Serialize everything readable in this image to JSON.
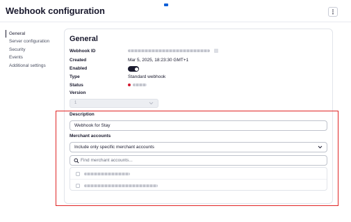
{
  "header": {
    "title": "Webhook configuration",
    "more_icon": "more-vertical-icon"
  },
  "sidebar": {
    "items": [
      {
        "label": "General",
        "active": true
      },
      {
        "label": "Server configuration",
        "active": false
      },
      {
        "label": "Security",
        "active": false
      },
      {
        "label": "Events",
        "active": false
      },
      {
        "label": "Additional settings",
        "active": false
      }
    ]
  },
  "general": {
    "title": "General",
    "fields": {
      "webhook_id": {
        "label": "Webhook ID"
      },
      "created": {
        "label": "Created",
        "value": "Mar 5, 2025, 18:23:30 GMT+1"
      },
      "enabled": {
        "label": "Enabled",
        "on": true
      },
      "type": {
        "label": "Type",
        "value": "Standard webhook"
      },
      "status": {
        "label": "Status",
        "color": "#d3172e"
      },
      "version": {
        "label": "Version",
        "value": "1"
      }
    }
  },
  "description": {
    "label": "Description",
    "value": "Webhook for Stay"
  },
  "merchant_accounts": {
    "label": "Merchant accounts",
    "selected": "Include only specific merchant accounts",
    "search_placeholder": "Find merchant accounts...",
    "accounts_count_visible": 2
  },
  "colors": {
    "accent": "#0f5fd7",
    "highlight_border": "#e02424",
    "toggle_on": "#1a1a2e"
  }
}
